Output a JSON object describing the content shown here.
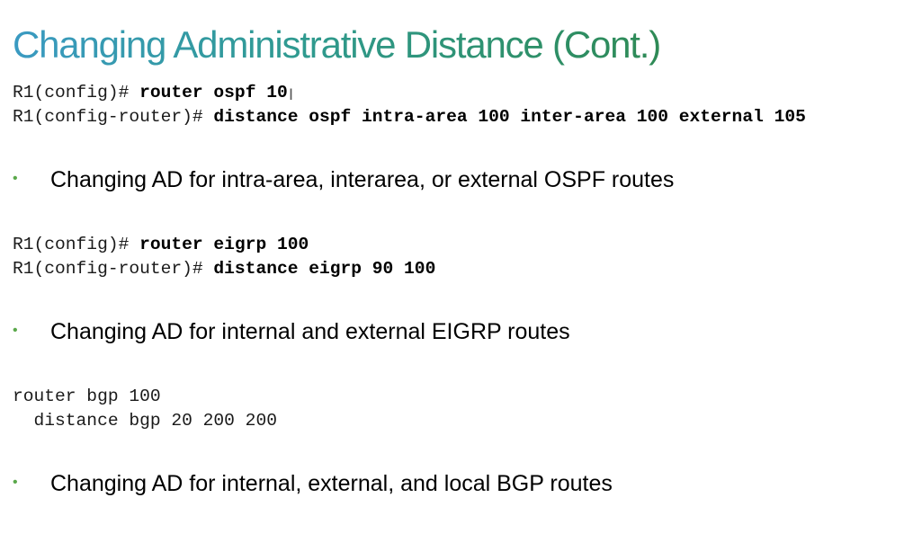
{
  "title": "Changing Administrative Distance (Cont.)",
  "ospf": {
    "line1_prompt": "R1(config)# ",
    "line1_cmd": "router ospf 10",
    "line2_prompt": "R1(config-router)# ",
    "line2_cmd": "distance ospf intra-area 100 inter-area 100 external 105",
    "bullet": "Changing AD for intra-area, interarea, or external OSPF routes"
  },
  "eigrp": {
    "line1_prompt": "R1(config)# ",
    "line1_cmd": "router eigrp 100",
    "line2_prompt": "R1(config-router)# ",
    "line2_cmd": "distance eigrp 90 100",
    "bullet": "Changing AD for internal and external EIGRP routes"
  },
  "bgp": {
    "line1": "router bgp 100",
    "line2": "  distance bgp 20 200 200",
    "bullet": "Changing AD for internal, external, and local BGP routes"
  },
  "bullet_symbol": "•",
  "colors": {
    "title_start": "#3a9ac2",
    "title_end": "#2e8a55",
    "bullet": "#5aa84a"
  }
}
